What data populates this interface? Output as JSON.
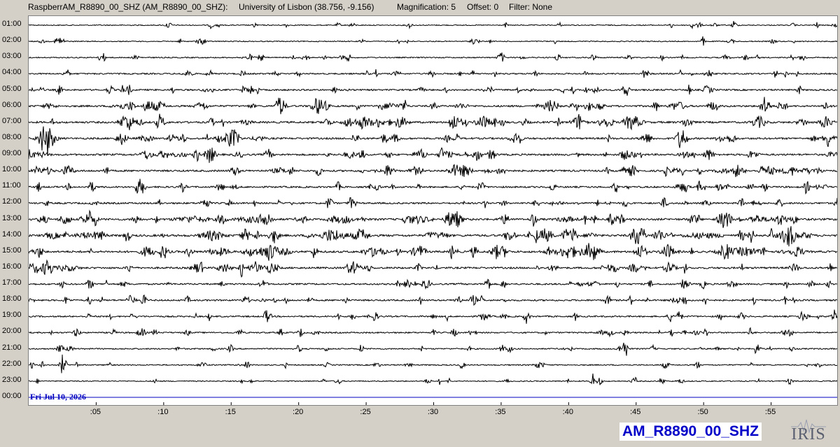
{
  "header": {
    "station": "RaspberrAM_R8890_00_SHZ (AM_R8890_00_SHZ):",
    "location": "University of Lisbon (38.756, -9.156)",
    "magnification": "Magnification: 5",
    "offset": "Offset: 0",
    "filter": "Filter: None"
  },
  "hours": [
    "01:00",
    "02:00",
    "03:00",
    "04:00",
    "05:00",
    "06:00",
    "07:00",
    "08:00",
    "09:00",
    "10:00",
    "11:00",
    "12:00",
    "13:00",
    "14:00",
    "15:00",
    "16:00",
    "17:00",
    "18:00",
    "19:00",
    "20:00",
    "21:00",
    "22:00",
    "23:00",
    "00:00"
  ],
  "minute_ticks": [
    ":05",
    ":10",
    ":15",
    ":20",
    ":25",
    ":30",
    ":35",
    ":40",
    ":45",
    ":50",
    ":55"
  ],
  "date_label": "Fri Jul 10, 2026",
  "station_label": "AM_R8890_00_SHZ",
  "logo_text": "IRIS",
  "colors": {
    "trace": "#000000",
    "current_line": "#0000c0",
    "label_blue": "#0000c8",
    "background": "#d4d0c8"
  },
  "trace_activity": [
    0.25,
    0.25,
    0.35,
    0.45,
    0.55,
    0.65,
    0.7,
    0.65,
    0.65,
    0.65,
    0.6,
    0.6,
    0.75,
    0.8,
    0.75,
    0.65,
    0.55,
    0.55,
    0.5,
    0.45,
    0.4,
    0.35,
    0.3,
    0.0
  ]
}
